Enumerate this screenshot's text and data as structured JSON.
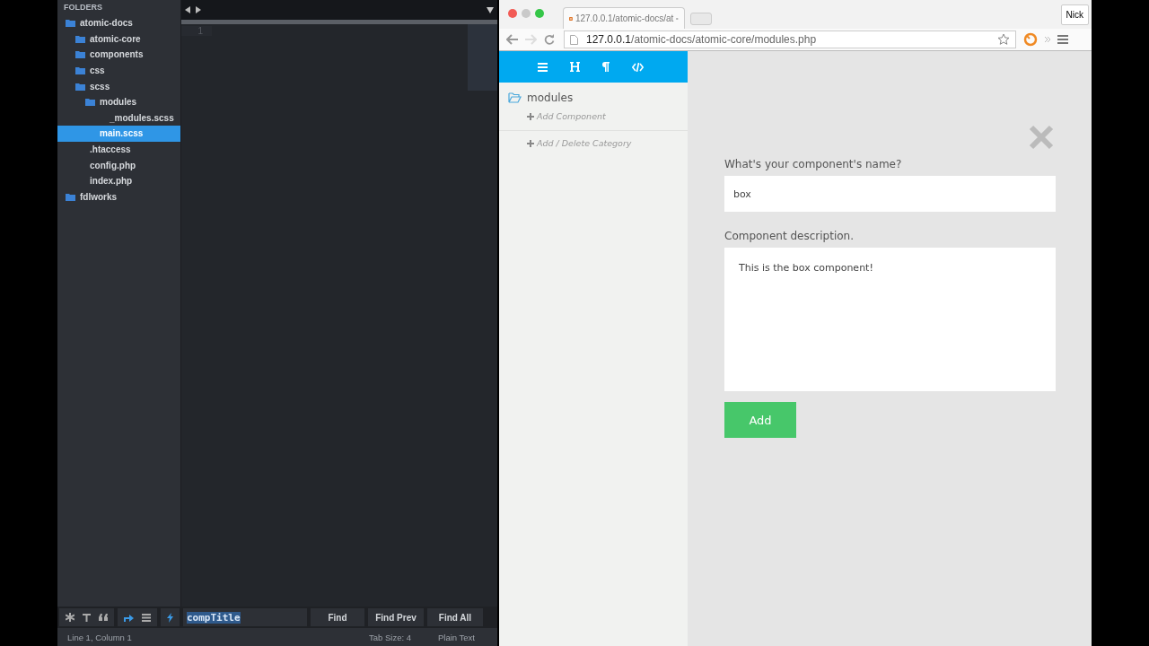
{
  "editor": {
    "sidebar": {
      "heading": "FOLDERS",
      "tree": [
        {
          "name": "atomic-docs",
          "kind": "folder",
          "selected": false,
          "children": [
            {
              "name": "atomic-core",
              "kind": "folder",
              "selected": false
            },
            {
              "name": "components",
              "kind": "folder",
              "selected": false
            },
            {
              "name": "css",
              "kind": "folder",
              "selected": false
            },
            {
              "name": "scss",
              "kind": "folder",
              "selected": false,
              "children": [
                {
                  "name": "modules",
                  "kind": "folder",
                  "selected": false,
                  "children": [
                    {
                      "name": "_modules.scss",
                      "kind": "file",
                      "selected": false
                    }
                  ]
                },
                {
                  "name": "main.scss",
                  "kind": "file",
                  "selected": true
                }
              ]
            },
            {
              "name": ".htaccess",
              "kind": "file",
              "selected": false
            },
            {
              "name": "config.php",
              "kind": "file",
              "selected": false
            },
            {
              "name": "index.php",
              "kind": "file",
              "selected": false
            }
          ]
        },
        {
          "name": "fdlworks",
          "kind": "folder",
          "selected": false
        }
      ]
    },
    "line_numbers": [
      "1"
    ],
    "find_bar": {
      "query": "compTitle",
      "buttons": [
        "Find",
        "Find Prev",
        "Find All"
      ]
    },
    "status_bar": {
      "position": "Line 1, Column 1",
      "tab_size": "Tab Size: 4",
      "syntax": "Plain Text"
    }
  },
  "browser": {
    "tab": {
      "title": "127.0.0.1/atomic-docs/at"
    },
    "profile": "Nick",
    "url": {
      "host": "127.0.0.1",
      "path": "/atomic-docs/atomic-core/modules.php"
    },
    "app": {
      "sidebar": {
        "category": "modules",
        "add_component": "Add Component",
        "add_category": "Add / Delete Category"
      },
      "form": {
        "name_label": "What's your component's name?",
        "name_value": "box",
        "desc_label": "Component description.",
        "desc_value": "This is the box component!",
        "submit": "Add"
      }
    }
  }
}
